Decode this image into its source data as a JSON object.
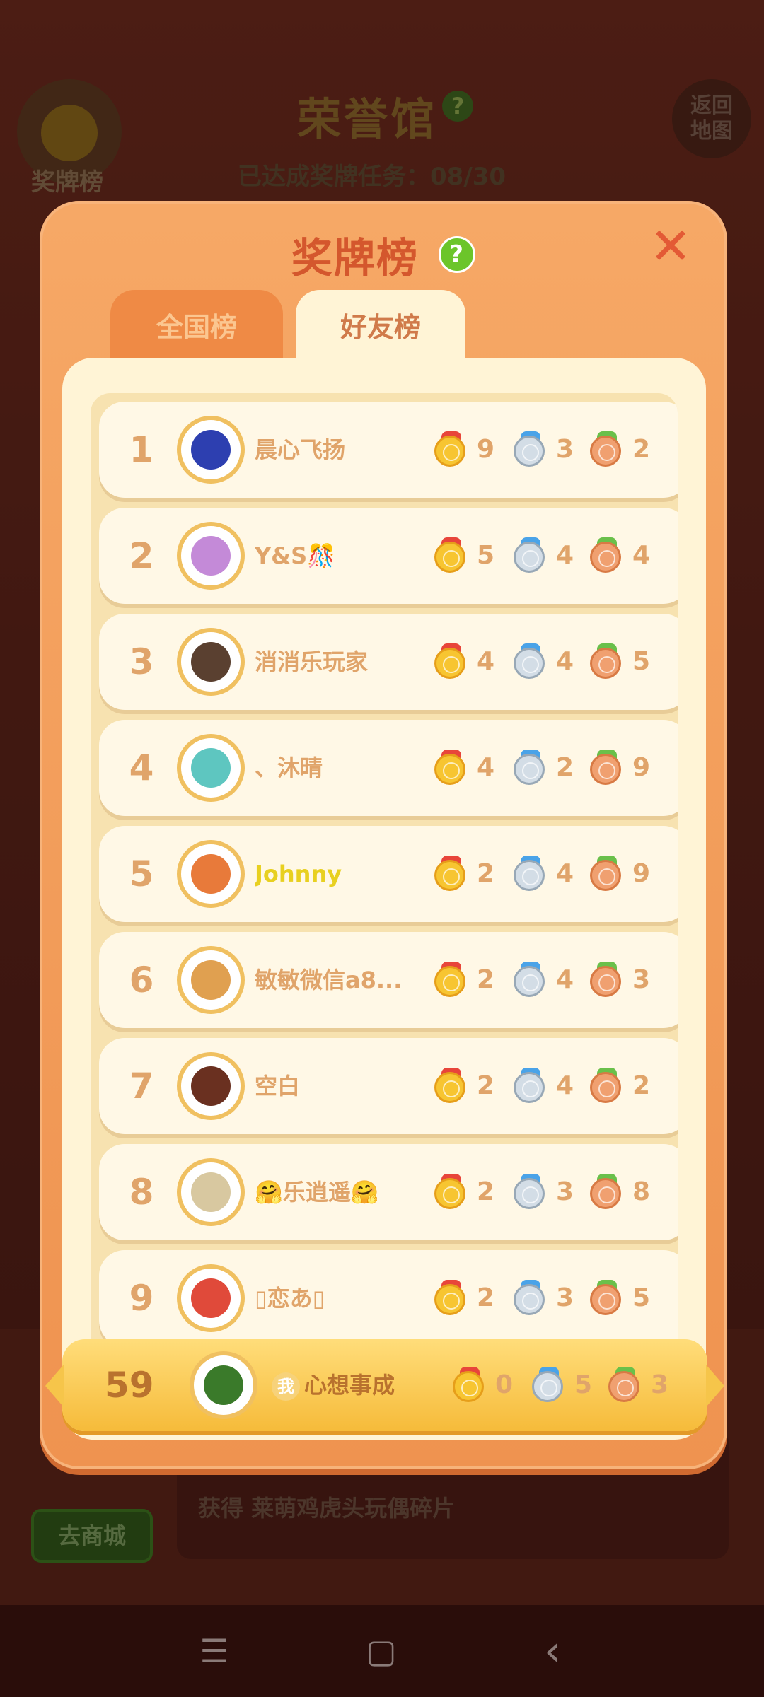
{
  "background": {
    "title": "荣誉馆",
    "progress_label": "已达成奖牌任务：",
    "progress_value": "08/30",
    "medal_button_label": "奖牌榜",
    "back_button_label": "返回\n地图",
    "shop_button_label": "去商城",
    "reward_text": "获得 莱萌鸡虎头玩偶碎片"
  },
  "modal": {
    "title": "奖牌榜",
    "help_icon": "?",
    "close_icon": "✕"
  },
  "tabs": [
    {
      "label": "全国榜",
      "active": false
    },
    {
      "label": "好友榜",
      "active": true
    }
  ],
  "rows": [
    {
      "rank": "1",
      "name": "晨心飞扬",
      "gold": "9",
      "silver": "3",
      "bronze": "2",
      "avatar_color": "#2d3fb0"
    },
    {
      "rank": "2",
      "name": "Y&S🎊",
      "gold": "5",
      "silver": "4",
      "bronze": "4",
      "avatar_color": "#c48ad8"
    },
    {
      "rank": "3",
      "name": "消消乐玩家",
      "gold": "4",
      "silver": "4",
      "bronze": "5",
      "avatar_color": "#5a4030"
    },
    {
      "rank": "4",
      "name": "、沐晴",
      "gold": "4",
      "silver": "2",
      "bronze": "9",
      "avatar_color": "#5ec6c0"
    },
    {
      "rank": "5",
      "name": "Johnny",
      "gold": "2",
      "silver": "4",
      "bronze": "9",
      "avatar_color": "#e87a3a",
      "name_color": "#e8d020"
    },
    {
      "rank": "6",
      "name": "敏敏微信a8...",
      "gold": "2",
      "silver": "4",
      "bronze": "3",
      "avatar_color": "#e0a050"
    },
    {
      "rank": "7",
      "name": "空白",
      "gold": "2",
      "silver": "4",
      "bronze": "2",
      "avatar_color": "#6a3020"
    },
    {
      "rank": "8",
      "name": "🤗乐逍遥🤗",
      "gold": "2",
      "silver": "3",
      "bronze": "8",
      "avatar_color": "#d8c8a0"
    },
    {
      "rank": "9",
      "name": "▯恋あ▯",
      "gold": "2",
      "silver": "3",
      "bronze": "5",
      "avatar_color": "#e04a3a"
    }
  ],
  "me": {
    "rank": "59",
    "tag": "我",
    "name": "心想事成",
    "gold": "0",
    "silver": "5",
    "bronze": "3",
    "avatar_color": "#3a7a2a"
  },
  "navbar": {
    "menu_icon": "☰",
    "home_icon": "▢",
    "back_icon": "‹"
  }
}
